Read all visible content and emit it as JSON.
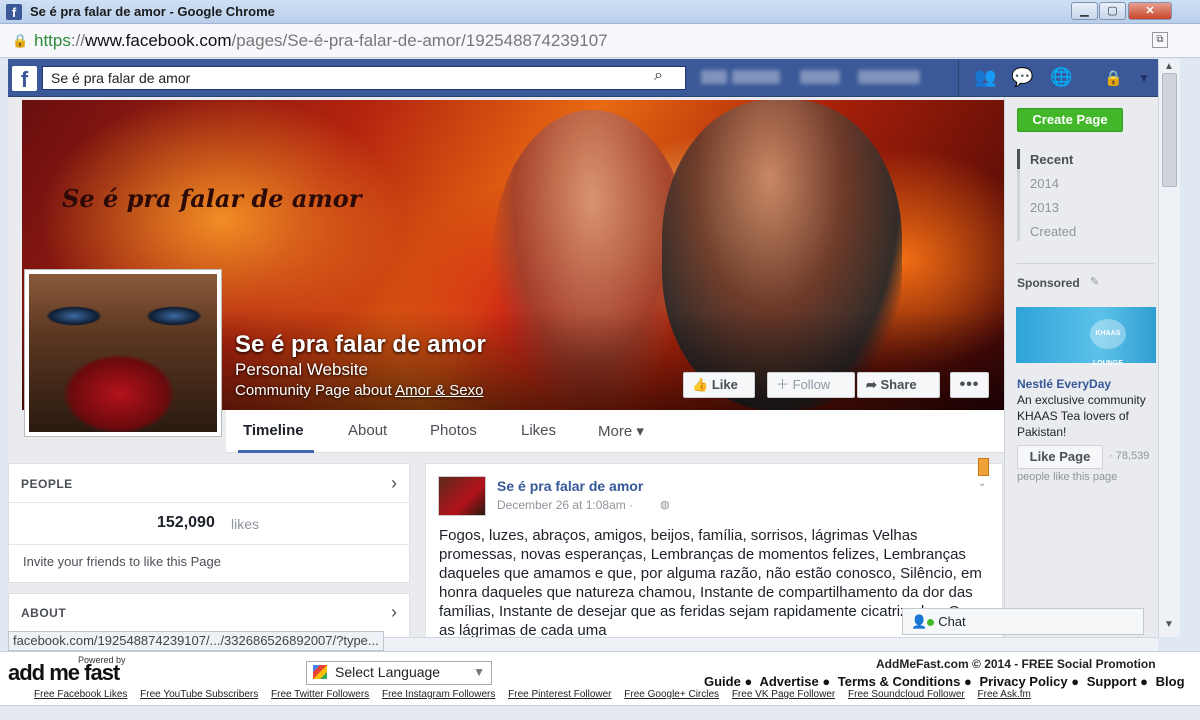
{
  "window": {
    "title": "Se é pra falar de amor - Google Chrome",
    "min_icon": "minimize-icon",
    "max_icon": "maximize-icon",
    "close_label": "✕"
  },
  "address": {
    "scheme": "https",
    "rest_prefix": "://",
    "host": "www.facebook.com",
    "path": "/pages/Se-é-pra-falar-de-amor/192548874239107"
  },
  "fb": {
    "logo": "f",
    "search_value": "Se é pra falar de amor"
  },
  "cover": {
    "script_title": "Se é pra falar de amor",
    "page_name": "Se é pra falar de amor",
    "category": "Personal Website",
    "about_prefix": "Community Page about ",
    "about_link": "Amor & Sexo",
    "like": "Like",
    "follow": "Follow",
    "share": "Share",
    "more": "•••"
  },
  "tabs": [
    {
      "label": "Timeline"
    },
    {
      "label": "About"
    },
    {
      "label": "Photos"
    },
    {
      "label": "Likes"
    },
    {
      "label": "More ▾"
    }
  ],
  "people": {
    "header": "PEOPLE",
    "count": "152,090",
    "count_label": "likes",
    "invite": "Invite your friends to like this Page"
  },
  "about": {
    "header": "ABOUT"
  },
  "post": {
    "author": "Se é pra falar de amor",
    "date": "December 26 at 1:08am ·",
    "body": "Fogos, luzes, abraços, amigos, beijos, família, sorrisos, lágrimas Velhas promessas, novas esperanças, Lembranças de momentos felizes, Lembranças daqueles que amamos e que, por alguma razão, não estão conosco, Silêncio, em honra daqueles que natureza chamou, Instante de compartilhamento da dor das famílias, Instante de desejar que as feridas sejam rapidamente cicatrizadas. Que as lágrimas de cada uma"
  },
  "rail": {
    "create_page": "Create Page",
    "years": [
      "Recent",
      "2014",
      "2013",
      "Created"
    ],
    "sponsored": "Sponsored",
    "ad_badge": "KHAAS LOUNGE",
    "ad_title": "Nestlé EveryDay",
    "ad_body": "An exclusive community KHAAS Tea lovers of Pakistan!",
    "like_page": "Like Page",
    "ad_count": "· 78,539",
    "ad_people": "people like this page"
  },
  "status_url": "facebook.com/192548874239107/.../332686526892007/?type...",
  "chat": "Chat",
  "addmefast": {
    "powered": "Powered by",
    "logo": "add me fast",
    "language": "Select Language",
    "copyright": "AddMeFast.com © 2014 - FREE Social Promotion",
    "links": [
      "Guide ●",
      "Advertise ●",
      "Terms & Conditions ●",
      "Privacy Policy ●",
      "Support ●",
      "Blog"
    ],
    "footer": [
      "Free Facebook Likes",
      "Free YouTube Subscribers",
      "Free Twitter Followers",
      "Free Instagram Followers",
      "Free Pinterest Follower",
      "Free Google+ Circles",
      "Free VK Page Follower",
      "Free Soundcloud Follower",
      "Free Ask.fm"
    ]
  }
}
